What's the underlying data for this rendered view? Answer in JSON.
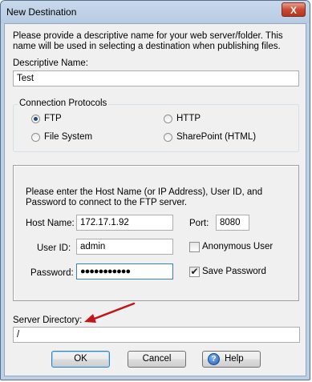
{
  "window": {
    "title": "New Destination",
    "close_glyph": "X"
  },
  "intro_text": "Please provide a descriptive name for your web server/folder. This name will be used in selecting a destination when publishing files.",
  "descriptive_name": {
    "label": "Descriptive Name:",
    "value": "Test"
  },
  "protocols": {
    "legend": "Connection Protocols",
    "selected": "FTP",
    "options": [
      {
        "label": "FTP",
        "checked": true
      },
      {
        "label": "HTTP",
        "checked": false
      },
      {
        "label": "File System",
        "checked": false
      },
      {
        "label": "SharePoint (HTML)",
        "checked": false
      }
    ]
  },
  "host_panel": {
    "instructions": "Please enter the Host Name (or IP Address), User ID, and Password to connect to the FTP server.",
    "host_label": "Host Name:",
    "host_value": "172.17.1.92",
    "port_label": "Port:",
    "port_value": "8080",
    "user_label": "User ID:",
    "user_value": "admin",
    "anonymous_label": "Anonymous User",
    "anonymous_checked": false,
    "password_label": "Password:",
    "password_value": "●●●●●●●●●●●",
    "save_password_label": "Save Password",
    "save_password_checked": true
  },
  "server_directory": {
    "label": "Server Directory:",
    "value": "/"
  },
  "buttons": {
    "ok": "OK",
    "cancel": "Cancel",
    "help": "Help",
    "help_icon_glyph": "?"
  },
  "annotation_color": "#c0161c",
  "colors": {
    "titlebar": "#bcd0e6",
    "dialog_bg": "#f0f0f0",
    "close_button": "#c9492f",
    "radio_dot": "#1c4a86"
  }
}
